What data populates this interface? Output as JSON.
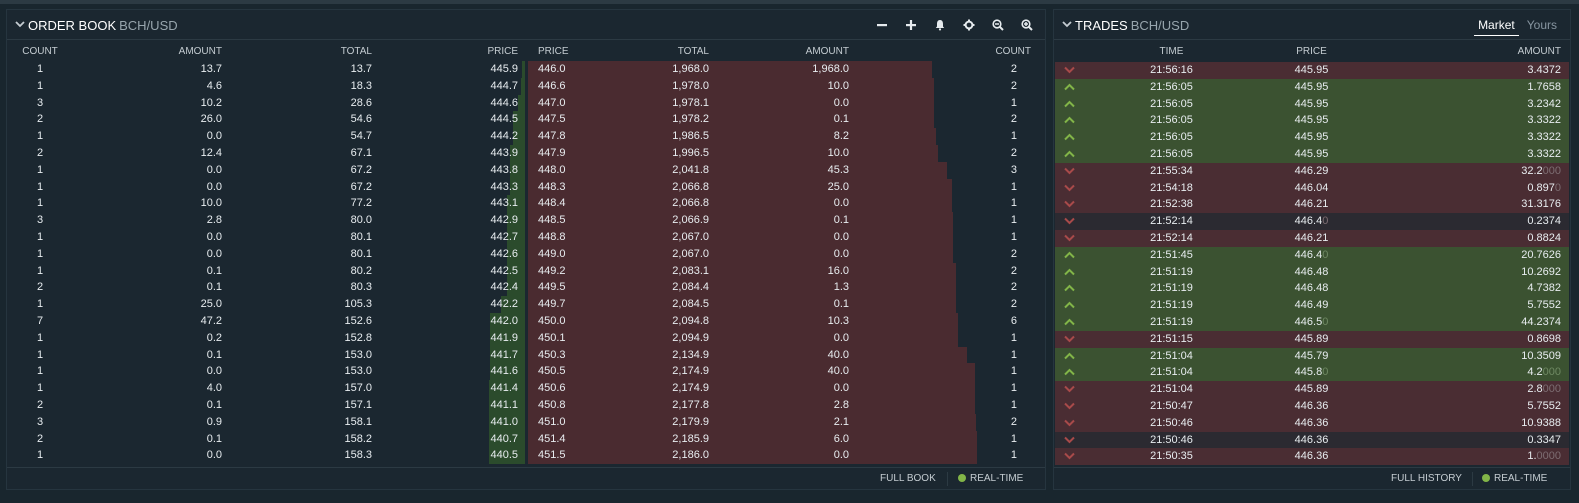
{
  "colors": {
    "bid_bar": "#2b4b2c",
    "ask_bar": "#4a2b30",
    "buy_row": "#3b5231",
    "sell_row": "#4a2d33",
    "up_arrow": "#82b548",
    "down_arrow": "#a84a4a",
    "realtime_dot": "#82b548"
  },
  "order_book": {
    "title": "ORDER BOOK",
    "pair": "BCH/USD",
    "tools": [
      "minus-icon",
      "plus-icon",
      "bell-icon",
      "gear-icon",
      "zoom-out-icon",
      "zoom-in-icon"
    ],
    "bid_headers": {
      "count": "COUNT",
      "amount": "AMOUNT",
      "total": "TOTAL",
      "price": "PRICE"
    },
    "ask_headers": {
      "price": "PRICE",
      "total": "TOTAL",
      "amount": "AMOUNT",
      "count": "COUNT"
    },
    "bids": [
      {
        "count": "1",
        "amount": "13.7",
        "total": "13.7",
        "price": "445.9",
        "depth": 0.087
      },
      {
        "count": "1",
        "amount": "4.6",
        "total": "18.3",
        "price": "444.7",
        "depth": 0.116
      },
      {
        "count": "3",
        "amount": "10.2",
        "total": "28.6",
        "price": "444.6",
        "depth": 0.181
      },
      {
        "count": "2",
        "amount": "26.0",
        "total": "54.6",
        "price": "444.5",
        "depth": 0.345
      },
      {
        "count": "1",
        "amount": "0.0",
        "total": "54.7",
        "price": "444.2",
        "depth": 0.346
      },
      {
        "count": "2",
        "amount": "12.4",
        "total": "67.1",
        "price": "443.9",
        "depth": 0.424
      },
      {
        "count": "1",
        "amount": "0.0",
        "total": "67.2",
        "price": "443.8",
        "depth": 0.425
      },
      {
        "count": "1",
        "amount": "0.0",
        "total": "67.2",
        "price": "443.3",
        "depth": 0.425
      },
      {
        "count": "1",
        "amount": "10.0",
        "total": "77.2",
        "price": "443.1",
        "depth": 0.488
      },
      {
        "count": "3",
        "amount": "2.8",
        "total": "80.0",
        "price": "442.9",
        "depth": 0.505
      },
      {
        "count": "1",
        "amount": "0.0",
        "total": "80.1",
        "price": "442.7",
        "depth": 0.506
      },
      {
        "count": "1",
        "amount": "0.0",
        "total": "80.1",
        "price": "442.6",
        "depth": 0.506
      },
      {
        "count": "1",
        "amount": "0.1",
        "total": "80.2",
        "price": "442.5",
        "depth": 0.507
      },
      {
        "count": "2",
        "amount": "0.1",
        "total": "80.3",
        "price": "442.4",
        "depth": 0.507
      },
      {
        "count": "1",
        "amount": "25.0",
        "total": "105.3",
        "price": "442.2",
        "depth": 0.665
      },
      {
        "count": "7",
        "amount": "47.2",
        "total": "152.6",
        "price": "442.0",
        "depth": 0.964
      },
      {
        "count": "1",
        "amount": "0.2",
        "total": "152.8",
        "price": "441.9",
        "depth": 0.965
      },
      {
        "count": "1",
        "amount": "0.1",
        "total": "153.0",
        "price": "441.7",
        "depth": 0.966
      },
      {
        "count": "1",
        "amount": "0.0",
        "total": "153.0",
        "price": "441.6",
        "depth": 0.966
      },
      {
        "count": "1",
        "amount": "4.0",
        "total": "157.0",
        "price": "441.4",
        "depth": 0.992
      },
      {
        "count": "2",
        "amount": "0.1",
        "total": "157.1",
        "price": "441.1",
        "depth": 0.992
      },
      {
        "count": "3",
        "amount": "0.9",
        "total": "158.1",
        "price": "441.0",
        "depth": 0.999
      },
      {
        "count": "2",
        "amount": "0.1",
        "total": "158.2",
        "price": "440.7",
        "depth": 0.999
      },
      {
        "count": "1",
        "amount": "0.0",
        "total": "158.3",
        "price": "440.5",
        "depth": 1.0
      }
    ],
    "asks": [
      {
        "price": "446.0",
        "total": "1,968.0",
        "amount": "1,968.0",
        "count": "2",
        "depth": 0.9
      },
      {
        "price": "446.6",
        "total": "1,978.0",
        "amount": "10.0",
        "count": "2",
        "depth": 0.905
      },
      {
        "price": "447.0",
        "total": "1,978.1",
        "amount": "0.0",
        "count": "1",
        "depth": 0.905
      },
      {
        "price": "447.5",
        "total": "1,978.2",
        "amount": "0.1",
        "count": "2",
        "depth": 0.905
      },
      {
        "price": "447.8",
        "total": "1,986.5",
        "amount": "8.2",
        "count": "1",
        "depth": 0.909
      },
      {
        "price": "447.9",
        "total": "1,996.5",
        "amount": "10.0",
        "count": "2",
        "depth": 0.913
      },
      {
        "price": "448.0",
        "total": "2,041.8",
        "amount": "45.3",
        "count": "3",
        "depth": 0.934
      },
      {
        "price": "448.3",
        "total": "2,066.8",
        "amount": "25.0",
        "count": "1",
        "depth": 0.945
      },
      {
        "price": "448.4",
        "total": "2,066.8",
        "amount": "0.0",
        "count": "1",
        "depth": 0.945
      },
      {
        "price": "448.5",
        "total": "2,066.9",
        "amount": "0.1",
        "count": "1",
        "depth": 0.946
      },
      {
        "price": "448.8",
        "total": "2,067.0",
        "amount": "0.0",
        "count": "1",
        "depth": 0.946
      },
      {
        "price": "449.0",
        "total": "2,067.0",
        "amount": "0.0",
        "count": "2",
        "depth": 0.946
      },
      {
        "price": "449.2",
        "total": "2,083.1",
        "amount": "16.0",
        "count": "2",
        "depth": 0.953
      },
      {
        "price": "449.5",
        "total": "2,084.4",
        "amount": "1.3",
        "count": "2",
        "depth": 0.954
      },
      {
        "price": "449.7",
        "total": "2,084.5",
        "amount": "0.1",
        "count": "2",
        "depth": 0.954
      },
      {
        "price": "450.0",
        "total": "2,094.8",
        "amount": "10.3",
        "count": "6",
        "depth": 0.958
      },
      {
        "price": "450.1",
        "total": "2,094.9",
        "amount": "0.0",
        "count": "1",
        "depth": 0.958
      },
      {
        "price": "450.3",
        "total": "2,134.9",
        "amount": "40.0",
        "count": "1",
        "depth": 0.977
      },
      {
        "price": "450.5",
        "total": "2,174.9",
        "amount": "40.0",
        "count": "1",
        "depth": 0.995
      },
      {
        "price": "450.6",
        "total": "2,174.9",
        "amount": "0.0",
        "count": "1",
        "depth": 0.995
      },
      {
        "price": "450.8",
        "total": "2,177.8",
        "amount": "2.8",
        "count": "1",
        "depth": 0.996
      },
      {
        "price": "451.0",
        "total": "2,179.9",
        "amount": "2.1",
        "count": "2",
        "depth": 0.997
      },
      {
        "price": "451.4",
        "total": "2,185.9",
        "amount": "6.0",
        "count": "1",
        "depth": 1.0
      },
      {
        "price": "451.5",
        "total": "2,186.0",
        "amount": "0.0",
        "count": "1",
        "depth": 1.0
      }
    ],
    "footer": {
      "full_book": "FULL BOOK",
      "real_time": "REAL-TIME"
    }
  },
  "trades": {
    "title": "TRADES",
    "pair": "BCH/USD",
    "tabs": [
      "Market",
      "Yours"
    ],
    "active_tab": "Market",
    "headers": {
      "time": "TIME",
      "price": "PRICE",
      "amount": "AMOUNT"
    },
    "rows": [
      {
        "side": "sell",
        "time": "21:56:16",
        "price": "445.95",
        "price_dim": "",
        "amount": "3.4372",
        "amount_dim": ""
      },
      {
        "side": "buy",
        "time": "21:56:05",
        "price": "445.95",
        "price_dim": "",
        "amount": "1.7658",
        "amount_dim": ""
      },
      {
        "side": "buy",
        "time": "21:56:05",
        "price": "445.95",
        "price_dim": "",
        "amount": "3.2342",
        "amount_dim": ""
      },
      {
        "side": "buy",
        "time": "21:56:05",
        "price": "445.95",
        "price_dim": "",
        "amount": "3.3322",
        "amount_dim": ""
      },
      {
        "side": "buy",
        "time": "21:56:05",
        "price": "445.95",
        "price_dim": "",
        "amount": "3.3322",
        "amount_dim": ""
      },
      {
        "side": "buy",
        "time": "21:56:05",
        "price": "445.95",
        "price_dim": "",
        "amount": "3.3322",
        "amount_dim": ""
      },
      {
        "side": "sell",
        "time": "21:55:34",
        "price": "446.29",
        "price_dim": "",
        "amount": "32.2",
        "amount_dim": "000"
      },
      {
        "side": "sell",
        "time": "21:54:18",
        "price": "446.04",
        "price_dim": "",
        "amount": "0.897",
        "amount_dim": "0"
      },
      {
        "side": "sell",
        "time": "21:52:38",
        "price": "446.21",
        "price_dim": "",
        "amount": "31.3176",
        "amount_dim": ""
      },
      {
        "side": "sell",
        "dark": true,
        "time": "21:52:14",
        "price": "446.4",
        "price_dim": "0",
        "amount": "0.2374",
        "amount_dim": ""
      },
      {
        "side": "sell",
        "time": "21:52:14",
        "price": "446.21",
        "price_dim": "",
        "amount": "0.8824",
        "amount_dim": ""
      },
      {
        "side": "buy",
        "time": "21:51:45",
        "price": "446.4",
        "price_dim": "0",
        "amount": "20.7626",
        "amount_dim": ""
      },
      {
        "side": "buy",
        "time": "21:51:19",
        "price": "446.48",
        "price_dim": "",
        "amount": "10.2692",
        "amount_dim": ""
      },
      {
        "side": "buy",
        "time": "21:51:19",
        "price": "446.48",
        "price_dim": "",
        "amount": "4.7382",
        "amount_dim": ""
      },
      {
        "side": "buy",
        "time": "21:51:19",
        "price": "446.49",
        "price_dim": "",
        "amount": "5.7552",
        "amount_dim": ""
      },
      {
        "side": "buy",
        "time": "21:51:19",
        "price": "446.5",
        "price_dim": "0",
        "amount": "44.2374",
        "amount_dim": ""
      },
      {
        "side": "sell",
        "time": "21:51:15",
        "price": "445.89",
        "price_dim": "",
        "amount": "0.8698",
        "amount_dim": ""
      },
      {
        "side": "buy",
        "time": "21:51:04",
        "price": "445.79",
        "price_dim": "",
        "amount": "10.3509",
        "amount_dim": ""
      },
      {
        "side": "buy",
        "time": "21:51:04",
        "price": "445.8",
        "price_dim": "0",
        "amount": "4.2",
        "amount_dim": "000"
      },
      {
        "side": "sell",
        "time": "21:51:04",
        "price": "445.89",
        "price_dim": "",
        "amount": "2.8",
        "amount_dim": "000"
      },
      {
        "side": "sell",
        "time": "21:50:47",
        "price": "446.36",
        "price_dim": "",
        "amount": "5.7552",
        "amount_dim": ""
      },
      {
        "side": "sell",
        "time": "21:50:46",
        "price": "446.36",
        "price_dim": "",
        "amount": "10.9388",
        "amount_dim": ""
      },
      {
        "side": "sell",
        "dark": true,
        "time": "21:50:46",
        "price": "446.36",
        "price_dim": "",
        "amount": "0.3347",
        "amount_dim": ""
      },
      {
        "side": "sell",
        "time": "21:50:35",
        "price": "446.36",
        "price_dim": "",
        "amount": "1.",
        "amount_dim": "0000"
      }
    ],
    "footer": {
      "full_history": "FULL HISTORY",
      "real_time": "REAL-TIME"
    }
  }
}
